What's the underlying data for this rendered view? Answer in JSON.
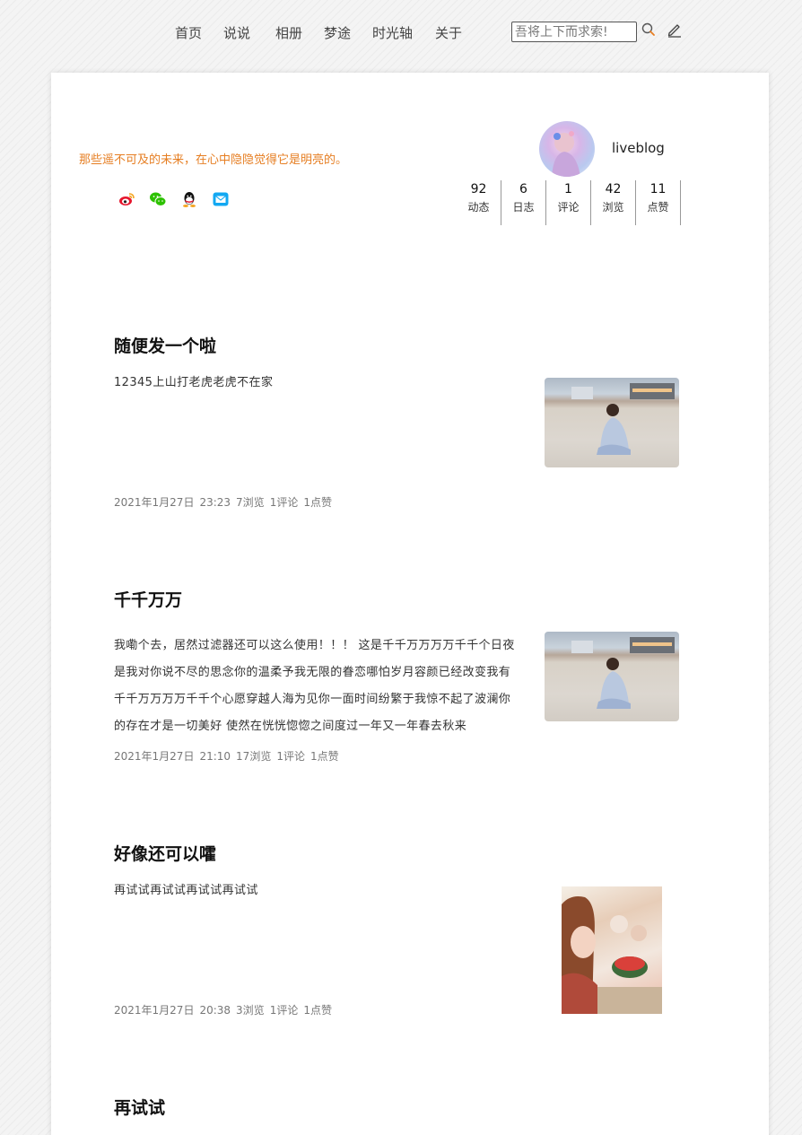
{
  "nav": {
    "items": [
      "首页",
      "说说",
      "相册",
      "梦途",
      "时光轴",
      "关于"
    ],
    "search_placeholder": "吾将上下而求索!",
    "search_icon": "search-icon",
    "write_icon": "pencil-icon"
  },
  "profile": {
    "motto": "那些遥不可及的未来，在心中隐隐觉得它是明亮的。",
    "blog_name": "liveblog",
    "social_icons": [
      "weibo-icon",
      "wechat-icon",
      "qq-icon",
      "email-icon"
    ],
    "stats": [
      {
        "value": "92",
        "label": "动态"
      },
      {
        "value": "6",
        "label": "日志"
      },
      {
        "value": "1",
        "label": "评论"
      },
      {
        "value": "42",
        "label": "浏览"
      },
      {
        "value": "11",
        "label": "点赞"
      }
    ]
  },
  "posts": [
    {
      "title": "随便发一个啦",
      "excerpt": "12345上山打老虎老虎不在家",
      "date": "2021年1月27日",
      "time": "23:23",
      "views": "7浏览",
      "comments": "1评论",
      "likes": "1点赞",
      "thumb": "beach-photo"
    },
    {
      "title": "千千万万",
      "excerpt": "我嘞个去，居然过滤器还可以这么使用！！！ 这是千千万万万万千千个日夜是我对你说不尽的思念你的温柔予我无限的眷恋哪怕岁月容颜已经改变我有千千万万万万千千个心愿穿越人海为见你一面时间纷繁于我惊不起了波澜你的存在才是一切美好 使然在恍恍惚惚之间度过一年又一年春去秋来",
      "date": "2021年1月27日",
      "time": "21:10",
      "views": "17浏览",
      "comments": "1评论",
      "likes": "1点赞",
      "thumb": "beach-photo"
    },
    {
      "title": "好像还可以嚯",
      "excerpt": "再试试再试试再试试再试试",
      "date": "2021年1月27日",
      "time": "20:38",
      "views": "3浏览",
      "comments": "1评论",
      "likes": "1点赞",
      "thumb": "party-photo"
    },
    {
      "title": "再试试"
    }
  ]
}
